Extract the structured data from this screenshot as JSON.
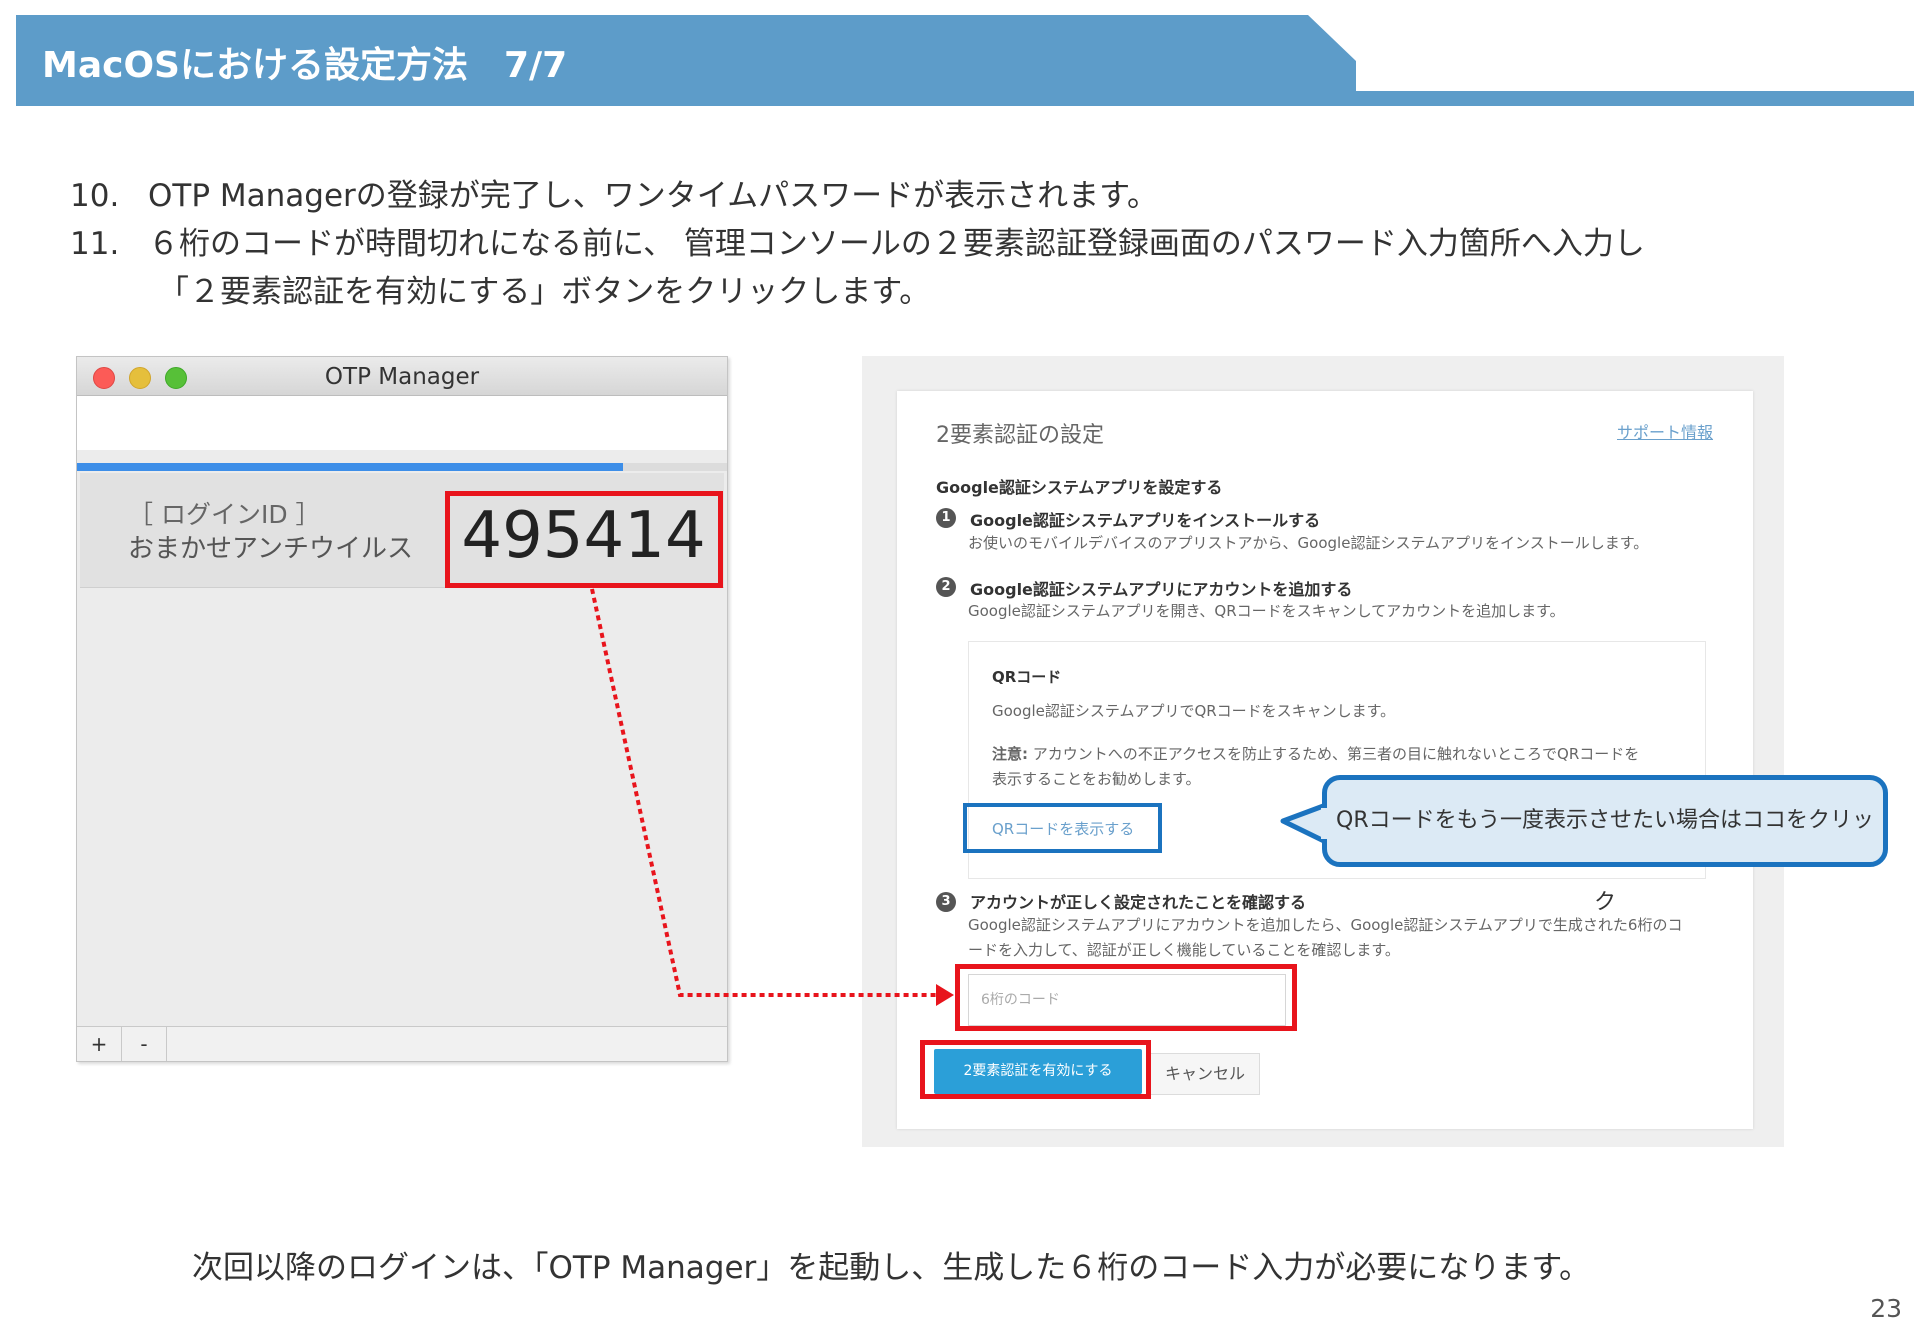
{
  "header": {
    "title": "MacOSにおける設定方法　7/7"
  },
  "steps": [
    {
      "num": "10.",
      "text": "OTP Managerの登録が完了し、ワンタイムパスワードが表示されます。"
    },
    {
      "num": "11.",
      "text": "６桁のコードが時間切れになる前に、 管理コンソールの２要素認証登録画面のパスワード入力箇所へ入力し",
      "text2": "「２要素認証を有効にする」ボタンをクリックします。"
    }
  ],
  "otp_window": {
    "title": "OTP Manager",
    "progress": 0.84,
    "login_label": "［ ログインID ］",
    "login_name": "おまかせアンチウイルス",
    "code": "495414",
    "add_button": "+",
    "remove_button": "-"
  },
  "settings": {
    "title": "2要素認証の設定",
    "support_link": "サポート情報",
    "section_title": "Google認証システムアプリを設定する",
    "step1": {
      "num": "1",
      "title": "Google認証システムアプリをインストールする",
      "desc": "お使いのモバイルデバイスのアプリストアから、Google認証システムアプリをインストールします。"
    },
    "step2": {
      "num": "2",
      "title": "Google認証システムアプリにアカウントを追加する",
      "desc": "Google認証システムアプリを開き、QRコードをスキャンしてアカウントを追加します。"
    },
    "qr": {
      "title": "QRコード",
      "desc": "Google認証システムアプリでQRコードをスキャンします。",
      "note_label": "注意:",
      "note_line1": "アカウントへの不正アクセスを防止するため、第三者の目に触れないところでQRコードを",
      "note_line2": "表示することをお勧めします。",
      "show_link": "QRコードを表示する"
    },
    "step3": {
      "num": "3",
      "title": "アカウントが正しく設定されたことを確認する",
      "desc1": "Google認証システムアプリにアカウントを追加したら、Google認証システムアプリで生成された6桁のコ",
      "desc2": "ードを入力して、認証が正しく機能していることを確認します。"
    },
    "code_placeholder": "6桁のコード",
    "enable_button": "2要素認証を有効にする",
    "cancel_button": "キャンセル"
  },
  "callout": {
    "text": "QRコードをもう一度表示させたい場合はココをクリック"
  },
  "footer": {
    "note": "次回以降のログインは、「OTP Manager」を起動し、生成した６桁のコード入力が必要になります。",
    "page": "23"
  },
  "colors": {
    "header": "#5d9cc9",
    "highlight_red": "#e8141c",
    "highlight_blue": "#1b73bf",
    "progress": "#3d8ee8",
    "button": "#2b9fd8"
  }
}
